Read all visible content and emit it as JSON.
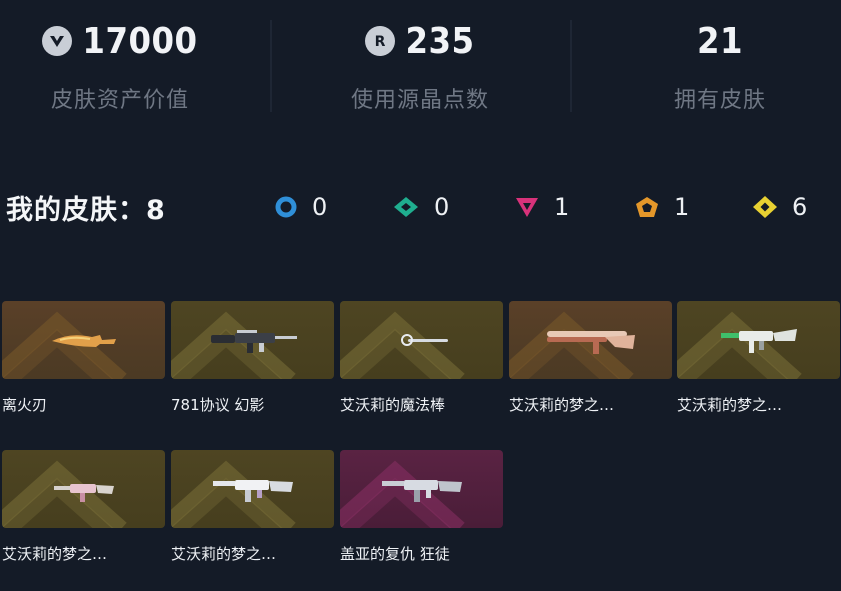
{
  "stats": [
    {
      "icon": "valorant-points-icon",
      "value": "17000",
      "label": "皮肤资产价值"
    },
    {
      "icon": "radianite-points-icon",
      "value": "235",
      "label": "使用源晶点数"
    },
    {
      "icon": "",
      "value": "21",
      "label": "拥有皮肤"
    }
  ],
  "my_skins": {
    "title": "我的皮肤：8",
    "tiers": [
      {
        "icon": "select-tier-icon",
        "color": "#2f8fd8",
        "count": "0"
      },
      {
        "icon": "deluxe-tier-icon",
        "color": "#1fae8f",
        "count": "0"
      },
      {
        "icon": "premium-tier-icon",
        "color": "#d8327a",
        "count": "1"
      },
      {
        "icon": "exclusive-tier-icon",
        "color": "#e4972a",
        "count": "1"
      },
      {
        "icon": "ultra-tier-icon",
        "color": "#e8d132",
        "count": "6"
      }
    ]
  },
  "skins": [
    {
      "name": "离火刃",
      "weapon": "knife-icon",
      "tier_bg": "orange"
    },
    {
      "name": "781协议 幻影",
      "weapon": "rifle-icon",
      "tier_bg": "gold"
    },
    {
      "name": "艾沃莉的魔法棒",
      "weapon": "wand-icon",
      "tier_bg": "gold"
    },
    {
      "name": "艾沃莉的梦之…",
      "weapon": "shotgun-icon",
      "tier_bg": "orange"
    },
    {
      "name": "艾沃莉的梦之…",
      "weapon": "rifle-icon",
      "tier_bg": "gold"
    },
    {
      "name": "艾沃莉的梦之…",
      "weapon": "smg-icon",
      "tier_bg": "gold"
    },
    {
      "name": "艾沃莉的梦之…",
      "weapon": "rifle-icon",
      "tier_bg": "gold"
    },
    {
      "name": "盖亚的复仇 狂徒",
      "weapon": "rifle-icon",
      "tier_bg": "pink"
    }
  ]
}
